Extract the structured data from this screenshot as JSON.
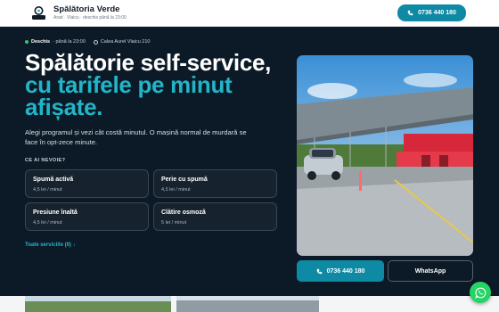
{
  "header": {
    "brand_name": "Spălătoria Verde",
    "brand_sub": "Arad · Vlaicu · deschis până la 23:00",
    "phone": "0736 440 180"
  },
  "hero": {
    "status_open": "Deschis",
    "status_hours": "· până la 23:00",
    "address": "Calea Aurel Vlaicu 210",
    "title_line1": "Spălătorie self-service,",
    "title_line2": "cu tarifele pe minut",
    "title_line3": "afișate.",
    "lead": "Alegi programul și vezi cât costă minutul. O mașină normal de murdară se face în opt-zece minute.",
    "need_label": "CE AI NEVOIE?",
    "services": [
      {
        "name": "Spumă activă",
        "price": "4,5 lei / minut"
      },
      {
        "name": "Perie cu spumă",
        "price": "4,5 lei / minut"
      },
      {
        "name": "Presiune înaltă",
        "price": "4,5 lei / minut"
      },
      {
        "name": "Clătire osmoză",
        "price": "5 lei / minut"
      }
    ],
    "all_services": "Toate serviciile (6) ↓",
    "call_button": "0736 440 180",
    "whatsapp_button": "WhatsApp"
  },
  "colors": {
    "accent": "#0f8aa5",
    "accent_text": "#22b5c8",
    "background": "#0c1a27",
    "whatsapp": "#25d366"
  },
  "icons": [
    "location-pin-icon",
    "phone-icon",
    "map-pin-icon",
    "whatsapp-icon"
  ]
}
